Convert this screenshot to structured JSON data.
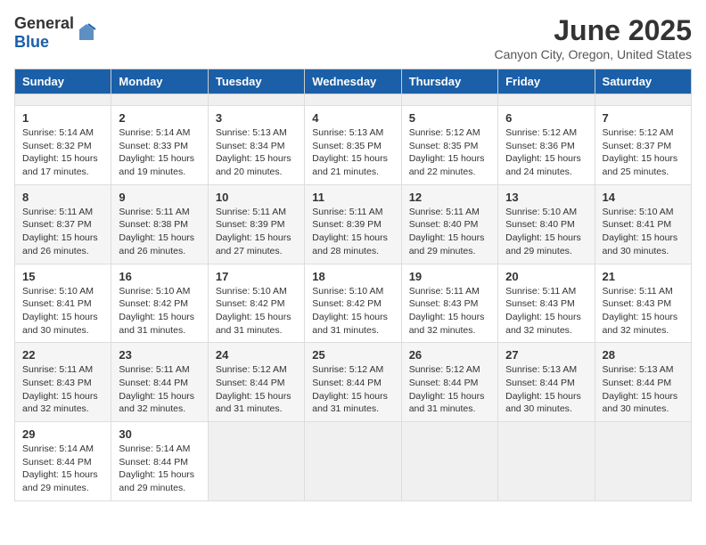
{
  "header": {
    "logo_general": "General",
    "logo_blue": "Blue",
    "month_title": "June 2025",
    "location": "Canyon City, Oregon, United States"
  },
  "calendar": {
    "days_of_week": [
      "Sunday",
      "Monday",
      "Tuesday",
      "Wednesday",
      "Thursday",
      "Friday",
      "Saturday"
    ],
    "weeks": [
      [
        {
          "day": null,
          "empty": true
        },
        {
          "day": null,
          "empty": true
        },
        {
          "day": null,
          "empty": true
        },
        {
          "day": null,
          "empty": true
        },
        {
          "day": null,
          "empty": true
        },
        {
          "day": null,
          "empty": true
        },
        {
          "day": null,
          "empty": true
        }
      ],
      [
        {
          "day": 1,
          "sunrise": "5:14 AM",
          "sunset": "8:32 PM",
          "daylight": "15 hours and 17 minutes."
        },
        {
          "day": 2,
          "sunrise": "5:14 AM",
          "sunset": "8:33 PM",
          "daylight": "15 hours and 19 minutes."
        },
        {
          "day": 3,
          "sunrise": "5:13 AM",
          "sunset": "8:34 PM",
          "daylight": "15 hours and 20 minutes."
        },
        {
          "day": 4,
          "sunrise": "5:13 AM",
          "sunset": "8:35 PM",
          "daylight": "15 hours and 21 minutes."
        },
        {
          "day": 5,
          "sunrise": "5:12 AM",
          "sunset": "8:35 PM",
          "daylight": "15 hours and 22 minutes."
        },
        {
          "day": 6,
          "sunrise": "5:12 AM",
          "sunset": "8:36 PM",
          "daylight": "15 hours and 24 minutes."
        },
        {
          "day": 7,
          "sunrise": "5:12 AM",
          "sunset": "8:37 PM",
          "daylight": "15 hours and 25 minutes."
        }
      ],
      [
        {
          "day": 8,
          "sunrise": "5:11 AM",
          "sunset": "8:37 PM",
          "daylight": "15 hours and 26 minutes."
        },
        {
          "day": 9,
          "sunrise": "5:11 AM",
          "sunset": "8:38 PM",
          "daylight": "15 hours and 26 minutes."
        },
        {
          "day": 10,
          "sunrise": "5:11 AM",
          "sunset": "8:39 PM",
          "daylight": "15 hours and 27 minutes."
        },
        {
          "day": 11,
          "sunrise": "5:11 AM",
          "sunset": "8:39 PM",
          "daylight": "15 hours and 28 minutes."
        },
        {
          "day": 12,
          "sunrise": "5:11 AM",
          "sunset": "8:40 PM",
          "daylight": "15 hours and 29 minutes."
        },
        {
          "day": 13,
          "sunrise": "5:10 AM",
          "sunset": "8:40 PM",
          "daylight": "15 hours and 29 minutes."
        },
        {
          "day": 14,
          "sunrise": "5:10 AM",
          "sunset": "8:41 PM",
          "daylight": "15 hours and 30 minutes."
        }
      ],
      [
        {
          "day": 15,
          "sunrise": "5:10 AM",
          "sunset": "8:41 PM",
          "daylight": "15 hours and 30 minutes."
        },
        {
          "day": 16,
          "sunrise": "5:10 AM",
          "sunset": "8:42 PM",
          "daylight": "15 hours and 31 minutes."
        },
        {
          "day": 17,
          "sunrise": "5:10 AM",
          "sunset": "8:42 PM",
          "daylight": "15 hours and 31 minutes."
        },
        {
          "day": 18,
          "sunrise": "5:10 AM",
          "sunset": "8:42 PM",
          "daylight": "15 hours and 31 minutes."
        },
        {
          "day": 19,
          "sunrise": "5:11 AM",
          "sunset": "8:43 PM",
          "daylight": "15 hours and 32 minutes."
        },
        {
          "day": 20,
          "sunrise": "5:11 AM",
          "sunset": "8:43 PM",
          "daylight": "15 hours and 32 minutes."
        },
        {
          "day": 21,
          "sunrise": "5:11 AM",
          "sunset": "8:43 PM",
          "daylight": "15 hours and 32 minutes."
        }
      ],
      [
        {
          "day": 22,
          "sunrise": "5:11 AM",
          "sunset": "8:43 PM",
          "daylight": "15 hours and 32 minutes."
        },
        {
          "day": 23,
          "sunrise": "5:11 AM",
          "sunset": "8:44 PM",
          "daylight": "15 hours and 32 minutes."
        },
        {
          "day": 24,
          "sunrise": "5:12 AM",
          "sunset": "8:44 PM",
          "daylight": "15 hours and 31 minutes."
        },
        {
          "day": 25,
          "sunrise": "5:12 AM",
          "sunset": "8:44 PM",
          "daylight": "15 hours and 31 minutes."
        },
        {
          "day": 26,
          "sunrise": "5:12 AM",
          "sunset": "8:44 PM",
          "daylight": "15 hours and 31 minutes."
        },
        {
          "day": 27,
          "sunrise": "5:13 AM",
          "sunset": "8:44 PM",
          "daylight": "15 hours and 30 minutes."
        },
        {
          "day": 28,
          "sunrise": "5:13 AM",
          "sunset": "8:44 PM",
          "daylight": "15 hours and 30 minutes."
        }
      ],
      [
        {
          "day": 29,
          "sunrise": "5:14 AM",
          "sunset": "8:44 PM",
          "daylight": "15 hours and 29 minutes."
        },
        {
          "day": 30,
          "sunrise": "5:14 AM",
          "sunset": "8:44 PM",
          "daylight": "15 hours and 29 minutes."
        },
        {
          "day": null,
          "empty": true
        },
        {
          "day": null,
          "empty": true
        },
        {
          "day": null,
          "empty": true
        },
        {
          "day": null,
          "empty": true
        },
        {
          "day": null,
          "empty": true
        }
      ]
    ]
  }
}
